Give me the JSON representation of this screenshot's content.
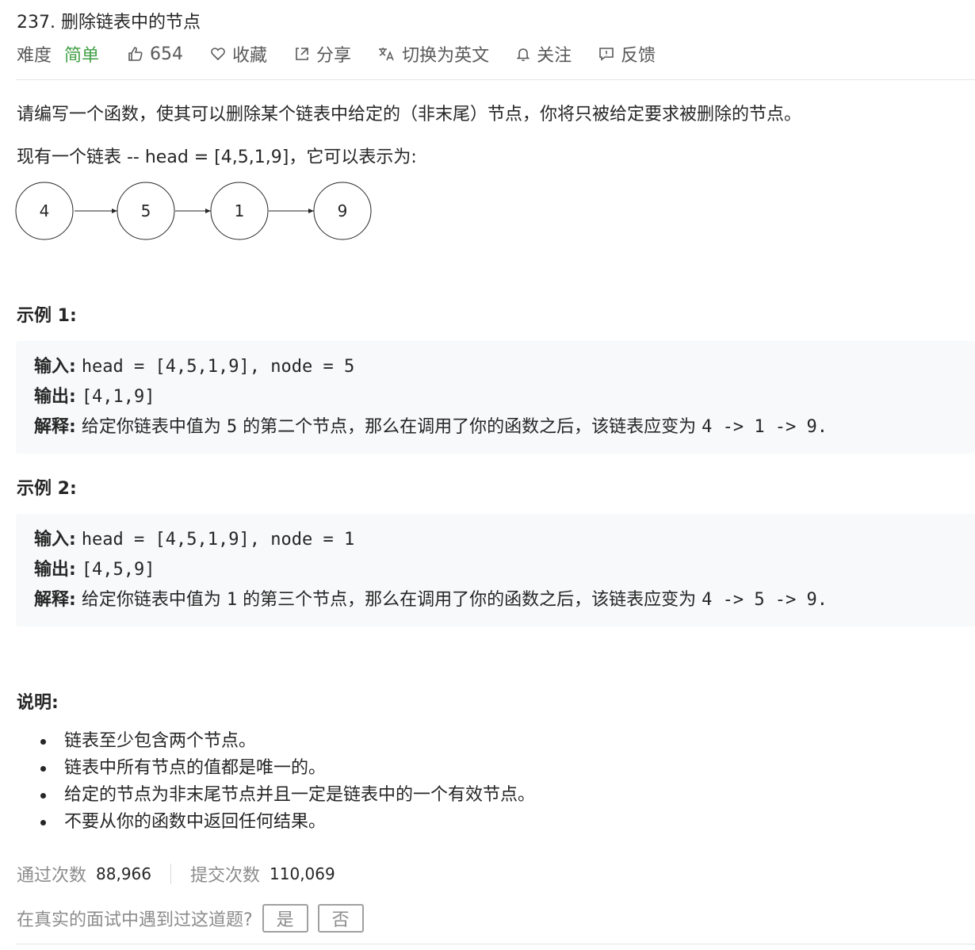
{
  "problem": {
    "title": "237. 删除链表中的节点"
  },
  "toolbar": {
    "difficulty_label": "难度",
    "difficulty_value": "简单",
    "difficulty_color": "#43a047",
    "likes": "654",
    "favorite_label": "收藏",
    "share_label": "分享",
    "switch_lang_label": "切换为英文",
    "follow_label": "关注",
    "feedback_label": "反馈"
  },
  "description": {
    "intro": "请编写一个函数，使其可以删除某个链表中给定的（非末尾）节点，你将只被给定要求被删除的节点。",
    "list_intro": "现有一个链表 -- head = [4,5,1,9]，它可以表示为:"
  },
  "diagram": {
    "nodes": [
      "4",
      "5",
      "1",
      "9"
    ]
  },
  "examples": [
    {
      "heading": "示例 1:",
      "input_label": "输入:",
      "input_value": "head = [4,5,1,9], node = 5",
      "output_label": "输出:",
      "output_value": "[4,1,9]",
      "explain_label": "解释:",
      "explain_a": "给定你链表中值为",
      "explain_num": "5",
      "explain_b": "的第二个节点，那么在调用了你的函数之后，该链表应变为",
      "explain_result": "4 -> 1 -> 9."
    },
    {
      "heading": "示例 2:",
      "input_label": "输入:",
      "input_value": "head = [4,5,1,9], node = 1",
      "output_label": "输出:",
      "output_value": "[4,5,9]",
      "explain_label": "解释:",
      "explain_a": "给定你链表中值为",
      "explain_num": "1",
      "explain_b": "的第三个节点，那么在调用了你的函数之后，该链表应变为",
      "explain_result": "4 -> 5 -> 9."
    }
  ],
  "notes": {
    "heading": "说明:",
    "items": [
      "链表至少包含两个节点。",
      "链表中所有节点的值都是唯一的。",
      "给定的节点为非末尾节点并且一定是链表中的一个有效节点。",
      "不要从你的函数中返回任何结果。"
    ]
  },
  "stats": {
    "accepted_label": "通过次数",
    "accepted_value": "88,966",
    "submitted_label": "提交次数",
    "submitted_value": "110,069"
  },
  "interview": {
    "question": "在真实的面试中遇到过这道题?",
    "yes_label": "是",
    "no_label": "否"
  }
}
